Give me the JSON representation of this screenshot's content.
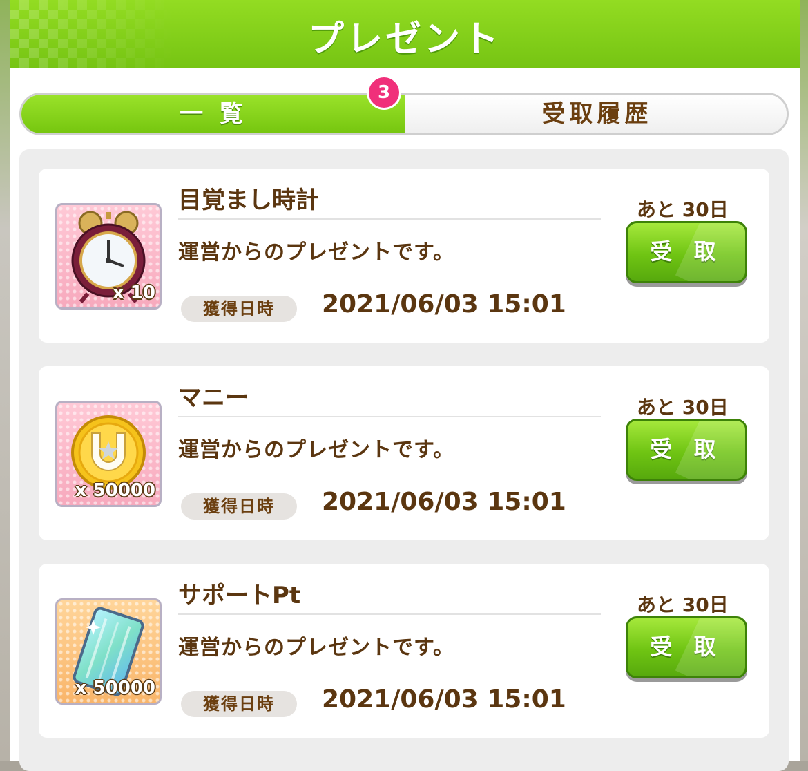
{
  "header": {
    "title": "プレゼント"
  },
  "tabs": [
    {
      "label": "一 覧",
      "active": true
    },
    {
      "label": "受取履歴",
      "active": false
    }
  ],
  "badge": {
    "count": "3"
  },
  "presents": [
    {
      "name": "目覚まし時計",
      "icon": "alarm-clock-icon",
      "quantity": "x 10",
      "description": "運営からのプレゼントです。",
      "date_label": "獲得日時",
      "date": "2021/06/03 15:01",
      "remaining": "あと 30日",
      "button": "受 取"
    },
    {
      "name": "マニー",
      "icon": "money-coin-icon",
      "quantity": "x 50000",
      "description": "運営からのプレゼントです。",
      "date_label": "獲得日時",
      "date": "2021/06/03 15:01",
      "remaining": "あと 30日",
      "button": "受 取"
    },
    {
      "name": "サポートPt",
      "icon": "support-card-icon",
      "quantity": "x 50000",
      "description": "運営からのプレゼントです。",
      "date_label": "獲得日時",
      "date": "2021/06/03 15:01",
      "remaining": "あと 30日",
      "button": "受 取"
    }
  ],
  "colors": {
    "accent_green": "#76c413",
    "text_brown": "#5b3610",
    "badge_pink": "#f0307a"
  }
}
